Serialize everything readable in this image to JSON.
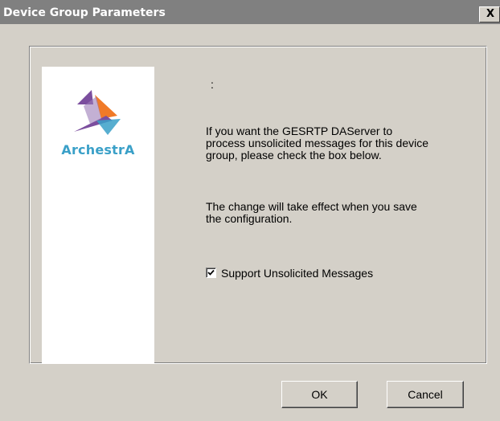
{
  "window": {
    "title": "Device Group Parameters",
    "close_label": "X"
  },
  "logo": {
    "text": "ArchestrA",
    "colors": {
      "purple": "#7b4e9e",
      "orange": "#f07a28",
      "blue": "#3aa0c8"
    },
    "icon": "archestra-logo-icon"
  },
  "content": {
    "colon": ":",
    "message1": "If you want the GESRTP DAServer to process unsolicited messages for this device group, please check the box below.",
    "message2": "The change will take effect when you save the configuration.",
    "checkbox": {
      "label": "Support Unsolicited Messages",
      "checked": true
    }
  },
  "buttons": {
    "ok_label": "OK",
    "cancel_label": "Cancel"
  }
}
